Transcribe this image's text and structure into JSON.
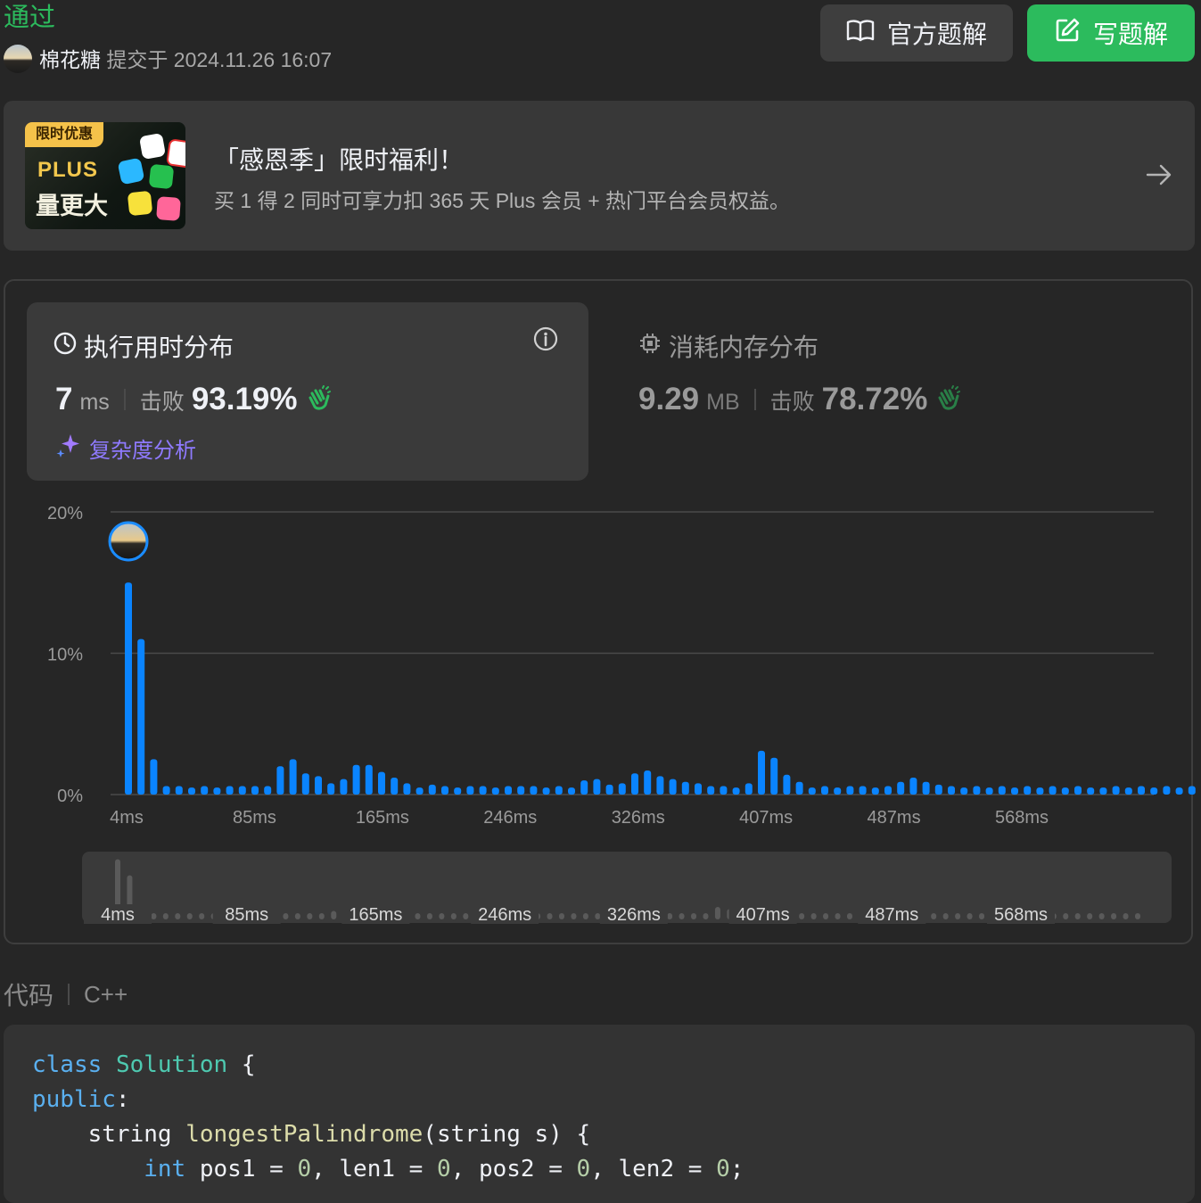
{
  "header": {
    "status": "通过",
    "username": "棉花糖",
    "submitted_label": "提交于",
    "submitted_time": "2024.11.26 16:07",
    "official_solution_label": "官方题解",
    "write_solution_label": "写题解"
  },
  "promo": {
    "badge": "限时优惠",
    "plus": "PLUS",
    "slogan": "量更大",
    "title": "「感恩季」限时福利！",
    "description": "买 1 得 2 同时可享力扣 365 天 Plus 会员 + 热门平台会员权益。"
  },
  "runtime": {
    "title": "执行用时分布",
    "value": "7",
    "unit": "ms",
    "beat_label": "击败",
    "beat_percent": "93.19%",
    "complexity_label": "复杂度分析"
  },
  "memory": {
    "title": "消耗内存分布",
    "value": "9.29",
    "unit": "MB",
    "beat_label": "击败",
    "beat_percent": "78.72%"
  },
  "chart_data": {
    "type": "bar",
    "title": "",
    "xlabel": "",
    "ylabel": "",
    "ylim": [
      0,
      20
    ],
    "y_ticks": [
      "20%",
      "10%",
      "0%"
    ],
    "x_tick_labels": [
      "4ms",
      "85ms",
      "165ms",
      "246ms",
      "326ms",
      "407ms",
      "487ms",
      "568ms"
    ],
    "highlight_index": 0,
    "grid": true,
    "values": [
      15.0,
      11.0,
      2.5,
      0.6,
      0.6,
      0.5,
      0.6,
      0.5,
      0.6,
      0.6,
      0.6,
      0.6,
      2.0,
      2.5,
      1.5,
      1.3,
      0.8,
      1.1,
      2.1,
      2.1,
      1.6,
      1.2,
      0.8,
      0.5,
      0.7,
      0.6,
      0.5,
      0.6,
      0.6,
      0.5,
      0.6,
      0.6,
      0.6,
      0.5,
      0.6,
      0.5,
      1.0,
      1.1,
      0.7,
      0.8,
      1.5,
      1.7,
      1.3,
      1.1,
      0.9,
      0.8,
      0.6,
      0.6,
      0.5,
      0.8,
      3.1,
      2.6,
      1.4,
      0.9,
      0.5,
      0.6,
      0.5,
      0.6,
      0.6,
      0.5,
      0.6,
      0.9,
      1.2,
      0.9,
      0.7,
      0.6,
      0.5,
      0.6,
      0.5,
      0.6,
      0.5,
      0.6,
      0.5,
      0.6,
      0.5,
      0.6,
      0.5,
      0.5,
      0.6,
      0.5,
      0.6,
      0.5,
      0.6,
      0.5,
      0.6,
      0.5
    ]
  },
  "code": {
    "header_label": "代码",
    "language": "C++"
  }
}
